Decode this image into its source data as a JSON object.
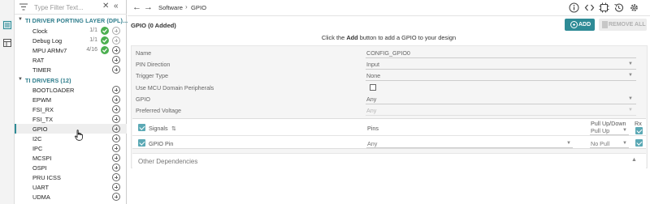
{
  "sidebar": {
    "filter_placeholder": "Type Filter Text...",
    "groups": [
      {
        "label": "TI DRIVER PORTING LAYER (DPL)..."
      },
      {
        "label": "TI DRIVERS (12)"
      }
    ],
    "dpl_items": [
      {
        "name": "Clock",
        "count": "1/1",
        "added": true
      },
      {
        "name": "Debug Log",
        "count": "1/1",
        "added": true
      },
      {
        "name": "MPU ARMv7",
        "count": "4/16",
        "added": true
      },
      {
        "name": "RAT",
        "count": "",
        "added": false
      },
      {
        "name": "TIMER",
        "count": "",
        "added": false
      }
    ],
    "driver_items": [
      {
        "name": "BOOTLOADER"
      },
      {
        "name": "EPWM"
      },
      {
        "name": "FSI_RX"
      },
      {
        "name": "FSI_TX"
      },
      {
        "name": "GPIO",
        "selected": true
      },
      {
        "name": "I2C"
      },
      {
        "name": "IPC"
      },
      {
        "name": "MCSPI"
      },
      {
        "name": "OSPI"
      },
      {
        "name": "PRU ICSS"
      },
      {
        "name": "UART"
      },
      {
        "name": "UDMA"
      }
    ]
  },
  "topbar": {
    "breadcrumb": [
      "Software",
      "GPIO"
    ],
    "separator": "›",
    "icons": [
      "info-icon",
      "code-icon",
      "pin-icon",
      "history-icon",
      "settings-icon"
    ]
  },
  "header": {
    "title": "GPIO (0 Added)",
    "add_label": "ADD",
    "remove_all_label": "REMOVE ALL"
  },
  "hint": {
    "prefix": "Click the ",
    "bold": "Add",
    "suffix": " button to add a GPIO to your design"
  },
  "form": {
    "fields": [
      {
        "label": "Name",
        "value": "CONFIG_GPIO0",
        "disabled": false,
        "dropdown": false
      },
      {
        "label": "PIN Direction",
        "value": "Input",
        "disabled": false,
        "dropdown": true
      },
      {
        "label": "Trigger Type",
        "value": "None",
        "disabled": false,
        "dropdown": true
      },
      {
        "label": "Use MCU Domain Peripherals",
        "value": "",
        "disabled": false,
        "dropdown": false
      },
      {
        "label": "GPIO",
        "value": "Any",
        "disabled": false,
        "dropdown": true
      },
      {
        "label": "Preferred Voltage",
        "value": "Any",
        "disabled": true,
        "dropdown": true
      }
    ]
  },
  "signals": {
    "header_label": "Signals",
    "pins_header": "Pins",
    "pull_header": "Pull Up/Down",
    "rx_header": "Rx",
    "header_pull_value": "Pull Up",
    "rows": [
      {
        "name": "GPIO Pin",
        "pin": "Any",
        "pull": "No Pull"
      }
    ]
  },
  "other_dependencies": {
    "label": "Other Dependencies"
  },
  "colors": {
    "accent": "#2e8b96",
    "added": "#4caf50",
    "group": "#2e7d8c"
  }
}
